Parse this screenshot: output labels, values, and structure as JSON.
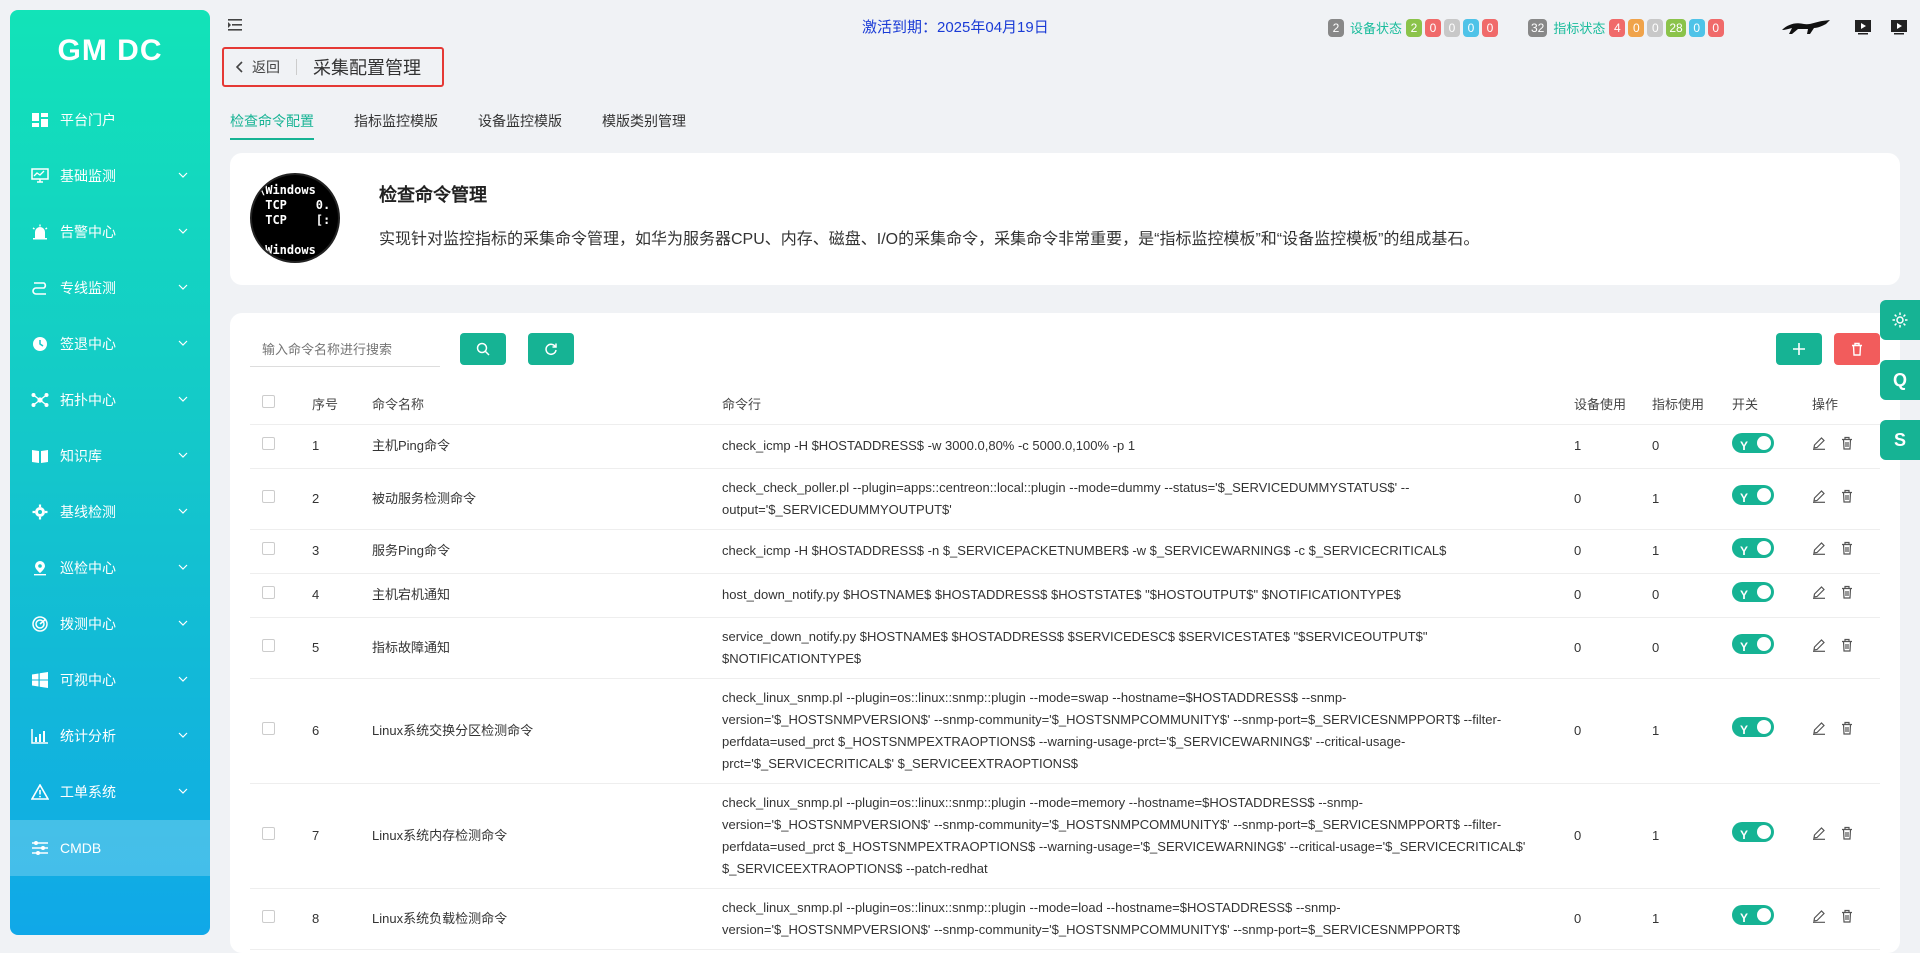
{
  "app": {
    "logo": "GM DC"
  },
  "sidebar": {
    "items": [
      {
        "label": "平台门户",
        "icon": "dashboard-icon",
        "has_children": false
      },
      {
        "label": "基础监测",
        "icon": "monitor-icon",
        "has_children": true
      },
      {
        "label": "告警中心",
        "icon": "alarm-icon",
        "has_children": true
      },
      {
        "label": "专线监测",
        "icon": "line-icon",
        "has_children": true
      },
      {
        "label": "签退中心",
        "icon": "clock-icon",
        "has_children": true
      },
      {
        "label": "拓扑中心",
        "icon": "topology-icon",
        "has_children": true
      },
      {
        "label": "知识库",
        "icon": "book-icon",
        "has_children": true
      },
      {
        "label": "基线检测",
        "icon": "gear-icon",
        "has_children": true
      },
      {
        "label": "巡检中心",
        "icon": "location-icon",
        "has_children": true
      },
      {
        "label": "拨测中心",
        "icon": "dial-icon",
        "has_children": true
      },
      {
        "label": "可视中心",
        "icon": "windows-icon",
        "has_children": true
      },
      {
        "label": "统计分析",
        "icon": "chart-icon",
        "has_children": true
      },
      {
        "label": "工单系统",
        "icon": "warning-icon",
        "has_children": true
      },
      {
        "label": "CMDB",
        "icon": "sliders-icon",
        "has_children": false,
        "active": true
      }
    ]
  },
  "topbar": {
    "activation": "激活到期：2025年04月19日",
    "device_status": {
      "label": "设备状态",
      "total": "2",
      "counts": [
        "2",
        "0",
        "0",
        "0",
        "0"
      ],
      "colors": [
        "#8bc34a",
        "#f06a6a",
        "#c8c8c8",
        "#4fc3e8",
        "#f06a6a"
      ]
    },
    "metric_status": {
      "label": "指标状态",
      "total": "32",
      "counts": [
        "4",
        "0",
        "0",
        "28",
        "0",
        "0"
      ],
      "colors": [
        "#f06a6a",
        "#f0a34a",
        "#c8c8c8",
        "#8bc34a",
        "#4fc3e8",
        "#f06a6a"
      ]
    }
  },
  "breadcrumb": {
    "back": "返回",
    "title": "采集配置管理"
  },
  "tabs": [
    {
      "label": "检查命令配置",
      "active": true
    },
    {
      "label": "指标监控模版",
      "active": false
    },
    {
      "label": "设备监控模版",
      "active": false
    },
    {
      "label": "模版类别管理",
      "active": false
    }
  ],
  "intro": {
    "avatar_text": "\\Windows\n TCP    0.\n TCP    [:\n\n\\Windows",
    "title": "检查命令管理",
    "desc": "实现针对监控指标的采集命令管理，如华为服务器CPU、内存、磁盘、I/O的采集命令，采集命令非常重要，是“指标监控模板”和“设备监控模板”的组成基石。"
  },
  "search": {
    "placeholder": "输入命令名称进行搜索"
  },
  "table": {
    "headers": {
      "index": "序号",
      "name": "命令名称",
      "cmd": "命令行",
      "device": "设备使用",
      "metric": "指标使用",
      "switch": "开关",
      "op": "操作"
    },
    "toggle_label": "Y",
    "rows": [
      {
        "index": "1",
        "name": "主机Ping命令",
        "cmd": "check_icmp -H $HOSTADDRESS$ -w 3000.0,80% -c 5000.0,100% -p 1",
        "device": "1",
        "metric": "0"
      },
      {
        "index": "2",
        "name": "被动服务检测命令",
        "cmd": "check_check_poller.pl --plugin=apps::centreon::local::plugin --mode=dummy --status='$_SERVICEDUMMYSTATUS$' --output='$_SERVICEDUMMYOUTPUT$'",
        "device": "0",
        "metric": "1"
      },
      {
        "index": "3",
        "name": "服务Ping命令",
        "cmd": "check_icmp -H $HOSTADDRESS$ -n $_SERVICEPACKETNUMBER$ -w $_SERVICEWARNING$ -c $_SERVICECRITICAL$",
        "device": "0",
        "metric": "1"
      },
      {
        "index": "4",
        "name": "主机宕机通知",
        "cmd": "host_down_notify.py $HOSTNAME$ $HOSTADDRESS$ $HOSTSTATE$ \"$HOSTOUTPUT$\" $NOTIFICATIONTYPE$",
        "device": "0",
        "metric": "0"
      },
      {
        "index": "5",
        "name": "指标故障通知",
        "cmd": "service_down_notify.py $HOSTNAME$ $HOSTADDRESS$ $SERVICEDESC$ $SERVICESTATE$ \"$SERVICEOUTPUT$\" $NOTIFICATIONTYPE$",
        "device": "0",
        "metric": "0"
      },
      {
        "index": "6",
        "name": "Linux系统交换分区检测命令",
        "cmd": "check_linux_snmp.pl --plugin=os::linux::snmp::plugin --mode=swap --hostname=$HOSTADDRESS$ --snmp-version='$_HOSTSNMPVERSION$' --snmp-community='$_HOSTSNMPCOMMUNITY$' --snmp-port=$_SERVICESNMPPORT$ --filter-perfdata=used_prct $_HOSTSNMPEXTRAOPTIONS$ --warning-usage-prct='$_SERVICEWARNING$' --critical-usage-prct='$_SERVICECRITICAL$' $_SERVICEEXTRAOPTIONS$",
        "device": "0",
        "metric": "1"
      },
      {
        "index": "7",
        "name": "Linux系统内存检测命令",
        "cmd": "check_linux_snmp.pl --plugin=os::linux::snmp::plugin --mode=memory --hostname=$HOSTADDRESS$ --snmp-version='$_HOSTSNMPVERSION$' --snmp-community='$_HOSTSNMPCOMMUNITY$' --snmp-port=$_SERVICESNMPPORT$ --filter-perfdata=used_prct $_HOSTSNMPEXTRAOPTIONS$ --warning-usage='$_SERVICEWARNING$' --critical-usage='$_SERVICECRITICAL$' $_SERVICEEXTRAOPTIONS$ --patch-redhat",
        "device": "0",
        "metric": "1"
      },
      {
        "index": "8",
        "name": "Linux系统负载检测命令",
        "cmd": "check_linux_snmp.pl --plugin=os::linux::snmp::plugin --mode=load --hostname=$HOSTADDRESS$ --snmp-version='$_HOSTSNMPVERSION$' --snmp-community='$_HOSTSNMPCOMMUNITY$' --snmp-port=$_SERVICESNMPPORT$",
        "device": "0",
        "metric": "1"
      }
    ]
  },
  "float_buttons": [
    "gear-icon",
    "Q",
    "S"
  ]
}
